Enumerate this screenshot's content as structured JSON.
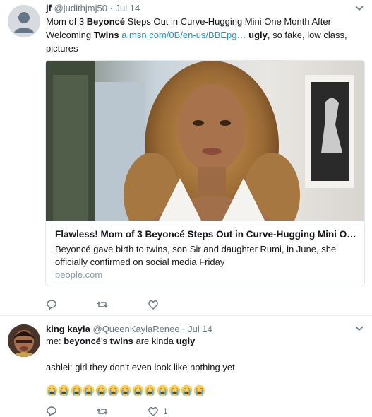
{
  "tweet1": {
    "name": "jf",
    "handle": "@judithjmj50",
    "sep": "·",
    "time": "Jul 14",
    "caret": "⌄",
    "text_segments": [
      {
        "t": "Mom of 3 ",
        "s": "plain"
      },
      {
        "t": "Beyoncé",
        "s": "bold"
      },
      {
        "t": " Steps Out in Curve-Hugging Mini One Month After Welcoming ",
        "s": "plain"
      },
      {
        "t": "Twins",
        "s": "bold"
      },
      {
        "t": " ",
        "s": "plain"
      },
      {
        "t": "a.msn.com/0B/en-us/BBEpg…",
        "s": "link"
      },
      {
        "t": " ",
        "s": "plain"
      },
      {
        "t": "ugly",
        "s": "bold"
      },
      {
        "t": ", so fake, low class, pictures",
        "s": "plain"
      }
    ],
    "card": {
      "title": "Flawless! Mom of 3 Beyoncé Steps Out in Curve-Hugging Mini On...",
      "description": "Beyoncé gave birth to twins, son Sir and daughter Rumi, in June, she officially confirmed on social media Friday",
      "domain": "people.com"
    },
    "actions": {
      "reply_icon": "reply-icon",
      "retweet_icon": "retweet-icon",
      "like_icon": "heart-icon",
      "like_count": ""
    }
  },
  "tweet2": {
    "name": "king kayla",
    "handle": "@QueenKaylaRenee",
    "sep": "·",
    "time": "Jul 14",
    "caret": "⌄",
    "line1_segments": [
      {
        "t": "me: ",
        "s": "plain"
      },
      {
        "t": "beyoncé",
        "s": "bold"
      },
      {
        "t": "'s ",
        "s": "plain"
      },
      {
        "t": "twins",
        "s": "bold"
      },
      {
        "t": " are kinda ",
        "s": "plain"
      },
      {
        "t": "ugly",
        "s": "bold"
      }
    ],
    "line2": "ashlei: girl they don't even look like nothing yet",
    "emoji_count": 13,
    "emoji_name": "loudly-crying-face-emoji",
    "actions": {
      "reply_icon": "reply-icon",
      "retweet_icon": "retweet-icon",
      "like_icon": "heart-icon",
      "like_count": "1"
    }
  },
  "colors": {
    "link": "#1b95e0",
    "secondary": "#657786",
    "border": "#e1e8ed"
  }
}
